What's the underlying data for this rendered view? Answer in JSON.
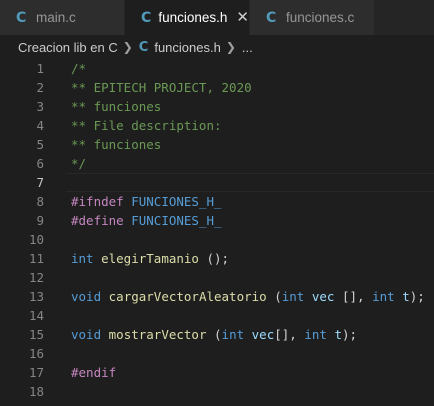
{
  "tabs": [
    {
      "icon": "C",
      "label": "main.c",
      "active": false
    },
    {
      "icon": "C",
      "label": "funciones.h",
      "active": true,
      "close": "✕"
    },
    {
      "icon": "C",
      "label": "funciones.c",
      "active": false
    }
  ],
  "breadcrumb": {
    "folder": "Creacion lib en C",
    "file_icon": "C",
    "file": "funciones.h",
    "more": "..."
  },
  "editor": {
    "cursor_line": 7,
    "lines": [
      {
        "n": "1",
        "tokens": [
          {
            "t": "/*",
            "c": "cm"
          }
        ]
      },
      {
        "n": "2",
        "tokens": [
          {
            "t": "** EPITECH PROJECT, 2020",
            "c": "cm"
          }
        ]
      },
      {
        "n": "3",
        "tokens": [
          {
            "t": "** funciones",
            "c": "cm"
          }
        ]
      },
      {
        "n": "4",
        "tokens": [
          {
            "t": "** File description:",
            "c": "cm"
          }
        ]
      },
      {
        "n": "5",
        "tokens": [
          {
            "t": "** funciones",
            "c": "cm"
          }
        ]
      },
      {
        "n": "6",
        "tokens": [
          {
            "t": "*/",
            "c": "cm"
          }
        ]
      },
      {
        "n": "7",
        "tokens": []
      },
      {
        "n": "8",
        "tokens": [
          {
            "t": "#ifndef",
            "c": "pp"
          },
          {
            "t": " ",
            "c": "pl"
          },
          {
            "t": "FUNCIONES_H_",
            "c": "mc"
          }
        ]
      },
      {
        "n": "9",
        "tokens": [
          {
            "t": "#define",
            "c": "pp"
          },
          {
            "t": " ",
            "c": "pl"
          },
          {
            "t": "FUNCIONES_H_",
            "c": "mc"
          }
        ]
      },
      {
        "n": "10",
        "tokens": []
      },
      {
        "n": "11",
        "tokens": [
          {
            "t": "int",
            "c": "kw"
          },
          {
            "t": " ",
            "c": "pl"
          },
          {
            "t": "elegirTamanio",
            "c": "fn"
          },
          {
            "t": " ();",
            "c": "pl"
          }
        ]
      },
      {
        "n": "12",
        "tokens": []
      },
      {
        "n": "13",
        "tokens": [
          {
            "t": "void",
            "c": "kw"
          },
          {
            "t": " ",
            "c": "pl"
          },
          {
            "t": "cargarVectorAleatorio",
            "c": "fn"
          },
          {
            "t": " (",
            "c": "pl"
          },
          {
            "t": "int",
            "c": "kw"
          },
          {
            "t": " ",
            "c": "pl"
          },
          {
            "t": "vec",
            "c": "vr"
          },
          {
            "t": " [], ",
            "c": "pl"
          },
          {
            "t": "int",
            "c": "kw"
          },
          {
            "t": " ",
            "c": "pl"
          },
          {
            "t": "t",
            "c": "vr"
          },
          {
            "t": ");",
            "c": "pl"
          }
        ]
      },
      {
        "n": "14",
        "tokens": []
      },
      {
        "n": "15",
        "tokens": [
          {
            "t": "void",
            "c": "kw"
          },
          {
            "t": " ",
            "c": "pl"
          },
          {
            "t": "mostrarVector",
            "c": "fn"
          },
          {
            "t": " (",
            "c": "pl"
          },
          {
            "t": "int",
            "c": "kw"
          },
          {
            "t": " ",
            "c": "pl"
          },
          {
            "t": "vec",
            "c": "vr"
          },
          {
            "t": "[], ",
            "c": "pl"
          },
          {
            "t": "int",
            "c": "kw"
          },
          {
            "t": " ",
            "c": "pl"
          },
          {
            "t": "t",
            "c": "vr"
          },
          {
            "t": ");",
            "c": "pl"
          }
        ]
      },
      {
        "n": "16",
        "tokens": []
      },
      {
        "n": "17",
        "tokens": [
          {
            "t": "#endif",
            "c": "pp"
          }
        ]
      },
      {
        "n": "18",
        "tokens": []
      }
    ]
  }
}
